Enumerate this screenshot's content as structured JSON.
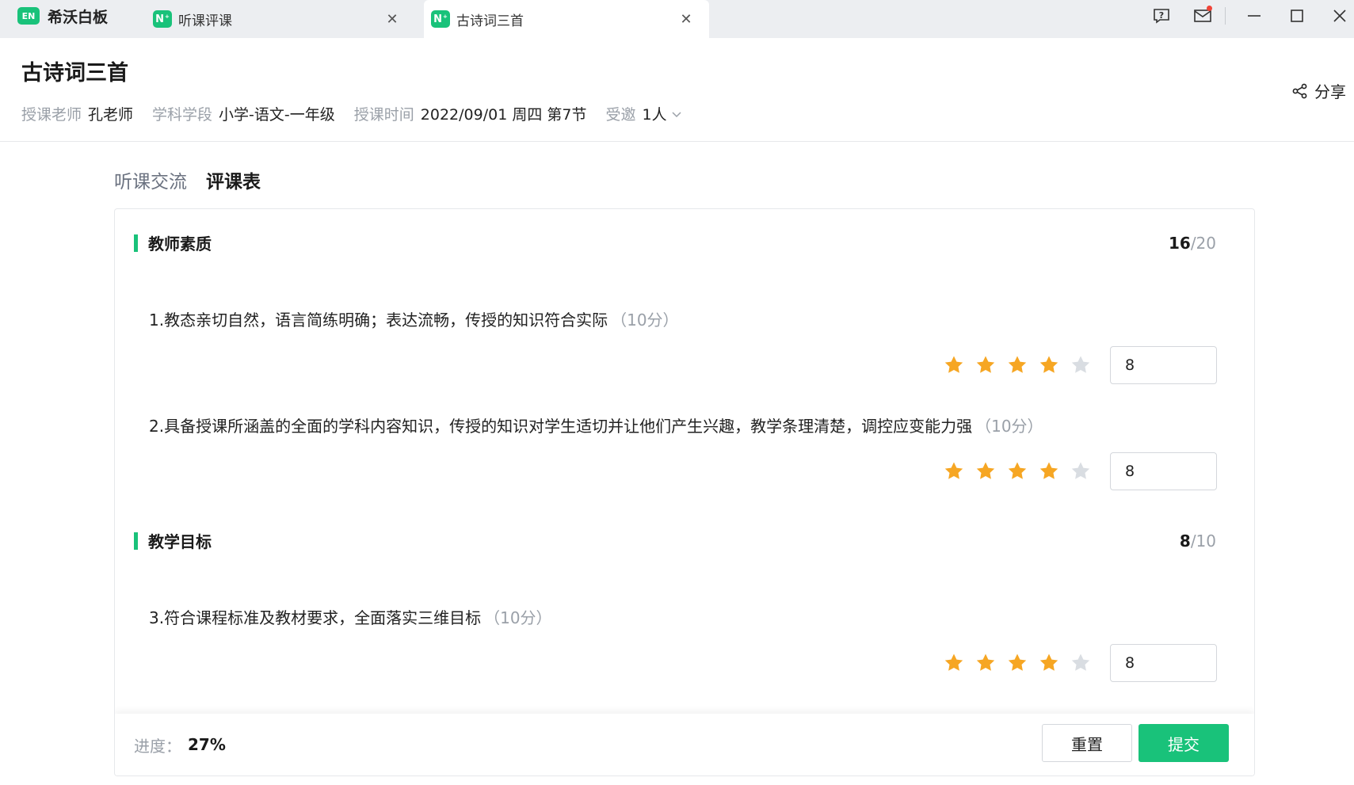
{
  "app": {
    "logo_text": "EN",
    "name": "希沃白板"
  },
  "tabs": [
    {
      "label": "听课评课"
    },
    {
      "label": "古诗词三首"
    }
  ],
  "tab_logo_text": "N",
  "header": {
    "title": "古诗词三首",
    "share_label": "分享",
    "meta": {
      "teacher_label": "授课老师",
      "teacher": "孔老师",
      "subject_label": "学科学段",
      "subject": "小学-语文-一年级",
      "time_label": "授课时间",
      "time": "2022/09/01 周四 第7节",
      "invite_label": "受邀",
      "invite": "1人"
    }
  },
  "subtabs": [
    {
      "label": "听课交流"
    },
    {
      "label": "评课表"
    }
  ],
  "form": {
    "sections": [
      {
        "title": "教师素质",
        "score": "16",
        "total": "/20",
        "questions": [
          {
            "text": "1.教态亲切自然，语言简练明确；表达流畅，传授的知识符合实际",
            "points": "（10分）",
            "rating": 4,
            "max_rating": 5,
            "value": "8"
          },
          {
            "text": "2.具备授课所涵盖的全面的学科内容知识，传授的知识对学生适切并让他们产生兴趣，教学条理清楚，调控应变能力强",
            "points": "（10分）",
            "rating": 4,
            "max_rating": 5,
            "value": "8"
          }
        ]
      },
      {
        "title": "教学目标",
        "score": "8",
        "total": "/10",
        "questions": [
          {
            "text": "3.符合课程标准及教材要求，全面落实三维目标",
            "points": "（10分）",
            "rating": 4,
            "max_rating": 5,
            "value": "8"
          }
        ]
      }
    ]
  },
  "footer": {
    "progress_label": "进度：",
    "progress_value": "27%",
    "reset_label": "重置",
    "submit_label": "提交"
  },
  "colors": {
    "accent": "#19c27a",
    "star_on": "#f6a623",
    "star_off": "#d9dde2"
  }
}
